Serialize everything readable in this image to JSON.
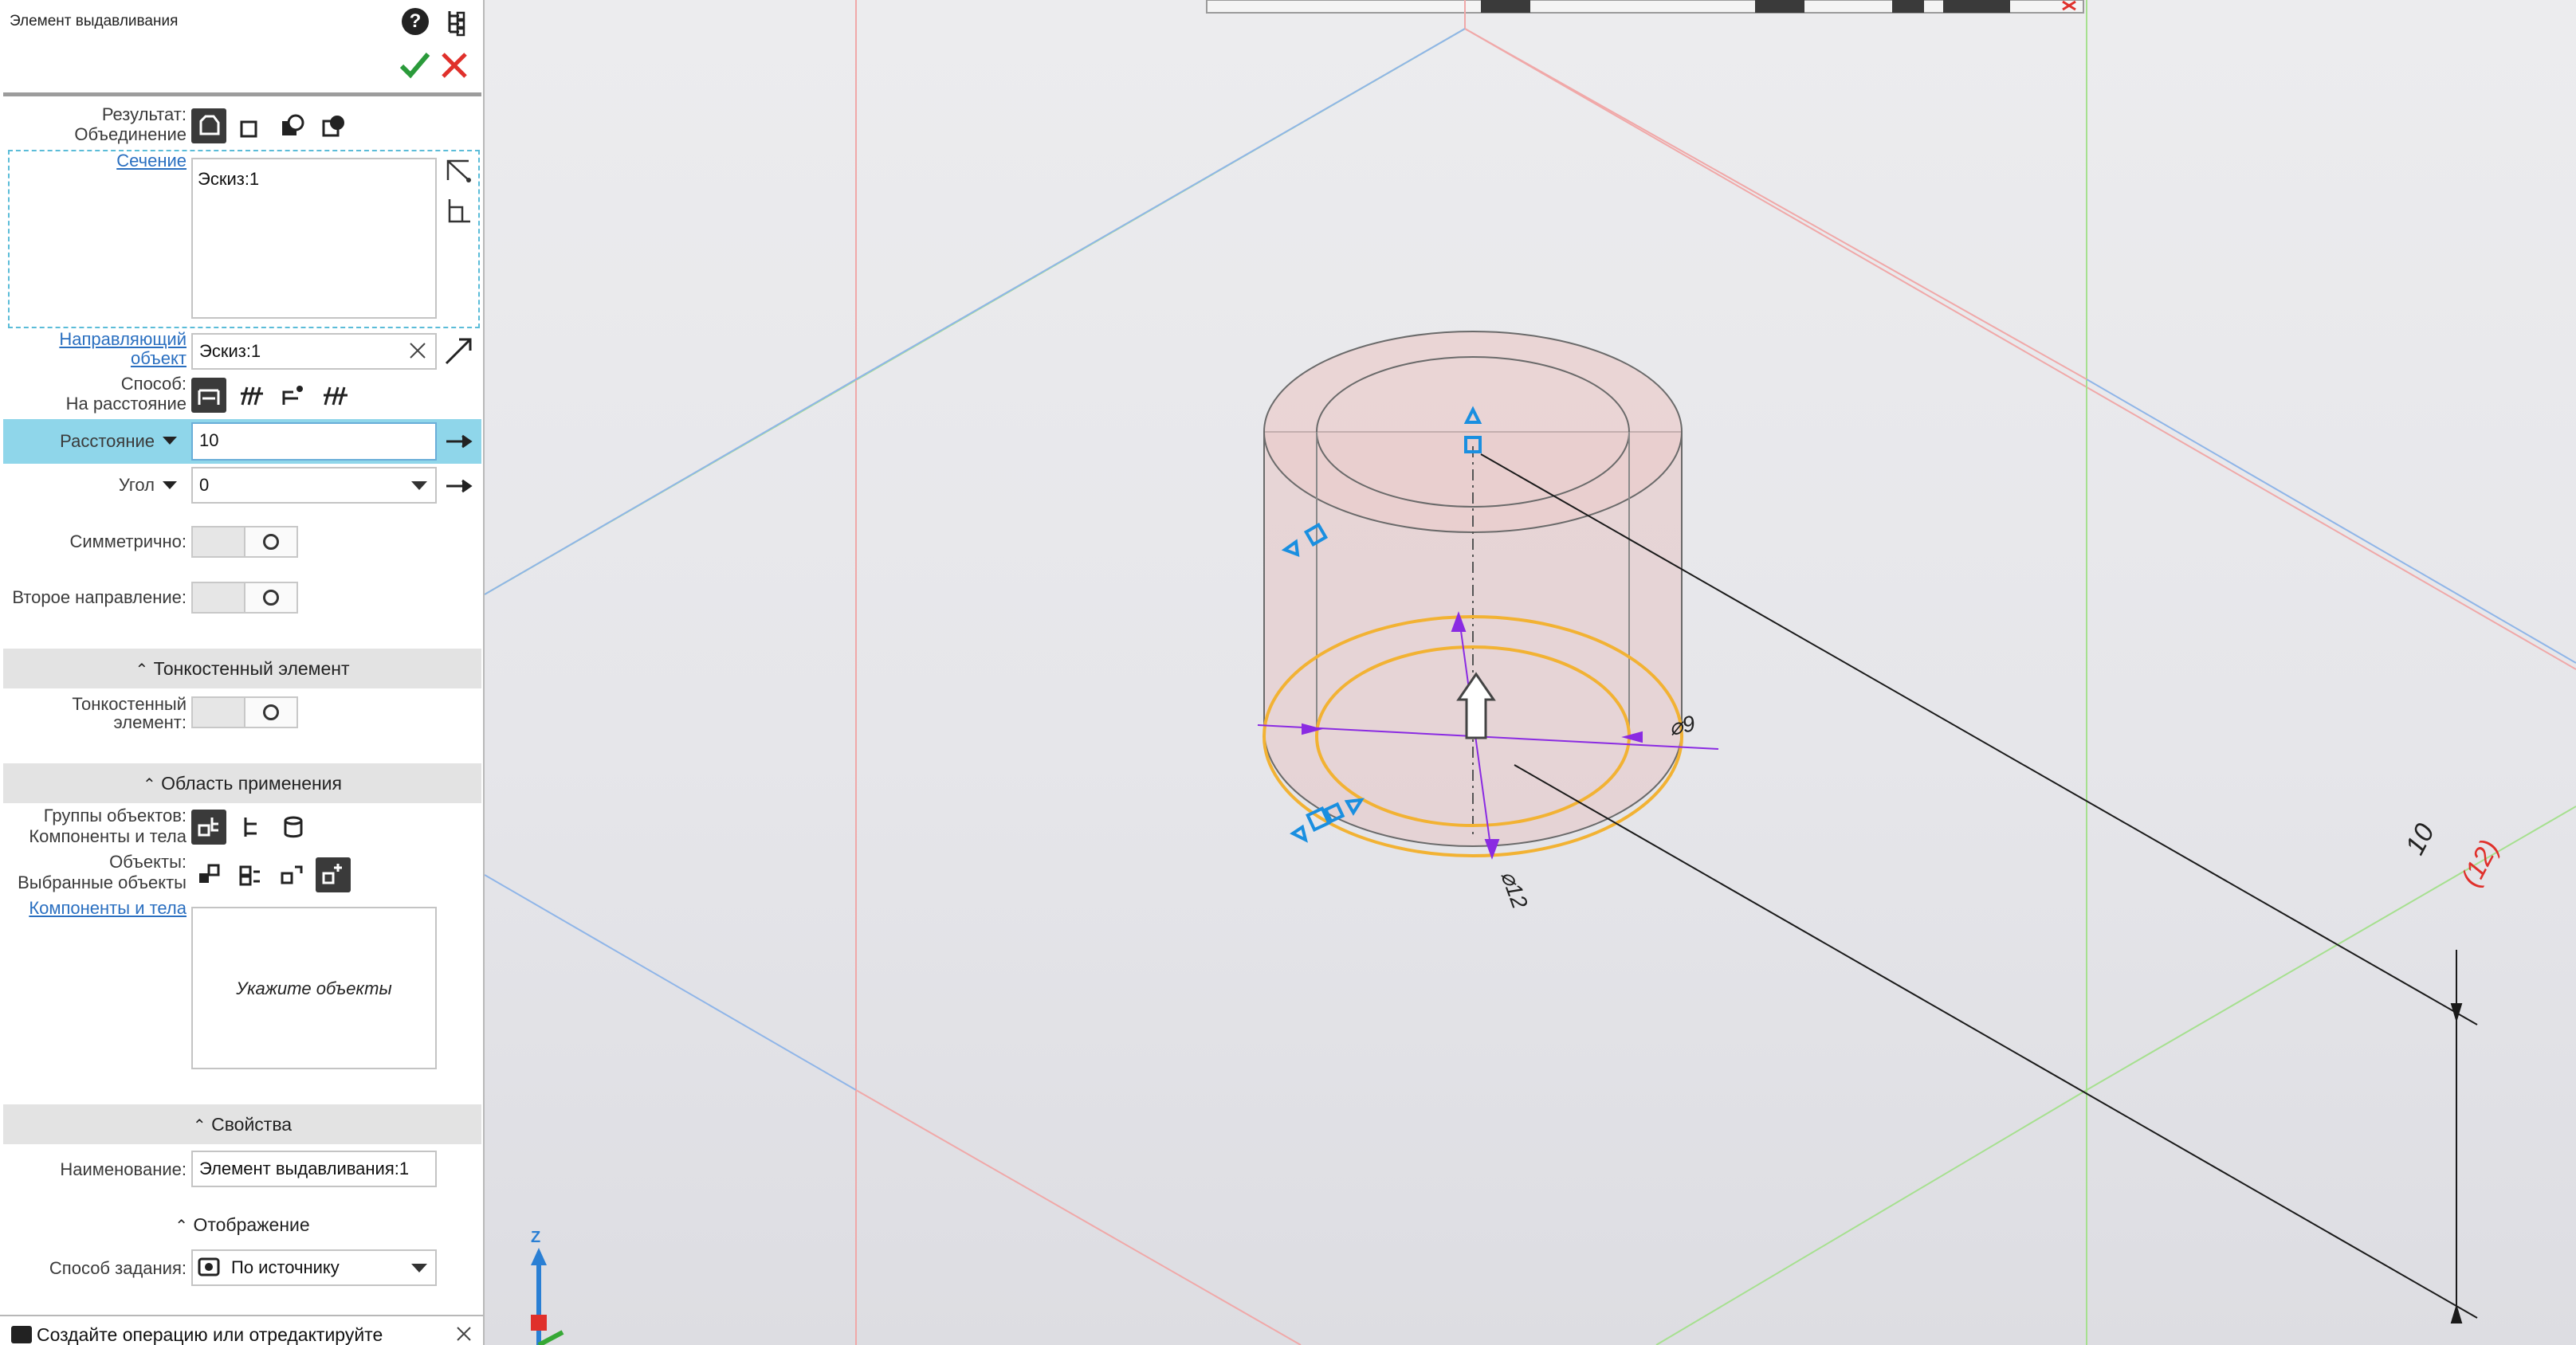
{
  "panel": {
    "title": "Элемент выдавливания",
    "result": {
      "label": "Результат:",
      "value": "Объединение"
    },
    "section_link": "Сечение",
    "section_list_item": "Эскиз:1",
    "guide": {
      "label_line1": "Направляющий",
      "label_line2": "объект",
      "value": "Эскиз:1"
    },
    "method": {
      "label": "Способ:",
      "value": "На расстояние"
    },
    "distance": {
      "label": "Расстояние",
      "value": "10"
    },
    "angle": {
      "label": "Угол",
      "value": "0"
    },
    "symmetric_label": "Симметрично:",
    "second_direction_label": "Второе направление:",
    "thin_wall": {
      "header": "Тонкостенный элемент",
      "label_line1": "Тонкостенный",
      "label_line2": "элемент:"
    },
    "scope": {
      "header": "Область применения",
      "groups_label": "Группы объектов:",
      "groups_value": "Компоненты и тела",
      "objects_label": "Объекты:",
      "objects_value": "Выбранные объекты",
      "components_link": "Компоненты и тела",
      "placeholder": "Укажите объекты"
    },
    "properties": {
      "header": "Свойства",
      "name_label": "Наименование:",
      "name_value": "Элемент выдавливания:1"
    },
    "display": {
      "header": "Отображение",
      "method_label": "Способ задания:",
      "method_value": "По источнику"
    },
    "status_text": "Создайте операцию или отредактируйте"
  },
  "viewport": {
    "dimensions": {
      "outer_diameter": "⌀12",
      "inner_diameter": "⌀9",
      "height": "10",
      "height_red": "(12)"
    },
    "axis_z": "Z"
  },
  "colors": {
    "accent_blue": "#1a8fe0",
    "highlight_row": "#8fd6ea",
    "ok_green": "#2a9a3a",
    "cancel_red": "#e0302b",
    "sketch_orange": "#f2b233",
    "dimension_purple": "#8a2be2"
  }
}
